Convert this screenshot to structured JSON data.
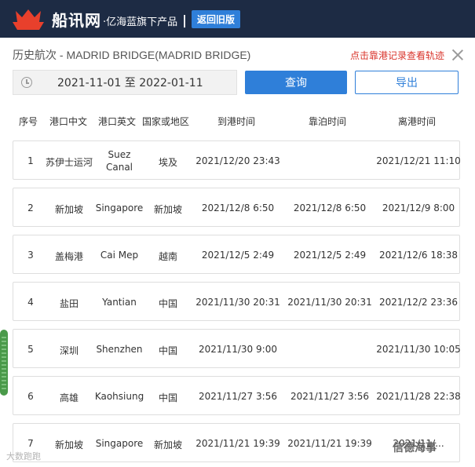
{
  "header": {
    "brand": "船讯网",
    "tagline": "·亿海蓝旗下产品",
    "separator": "|",
    "back_label": "返回旧版"
  },
  "page": {
    "title": "历史航次 - MADRID BRIDGE(MADRID BRIDGE)",
    "track_link": "点击靠港记录查看轨迹"
  },
  "filters": {
    "date_range": "2021-11-01 至 2022-01-11",
    "query_label": "查询",
    "export_label": "导出"
  },
  "table": {
    "columns": [
      "序号",
      "港口中文",
      "港口英文",
      "国家或地区",
      "到港时间",
      "靠泊时间",
      "离港时间"
    ],
    "rows": [
      {
        "no": "1",
        "port_cn": "苏伊士运河",
        "port_en_1": "Suez",
        "port_en_2": "Canal",
        "country": "埃及",
        "arrive": "2021/12/20 23:43",
        "berth": "",
        "depart": "2021/12/21 11:10"
      },
      {
        "no": "2",
        "port_cn": "新加坡",
        "port_en": "Singapore",
        "country": "新加坡",
        "arrive": "2021/12/8 6:50",
        "berth": "2021/12/8 6:50",
        "depart": "2021/12/9 8:00"
      },
      {
        "no": "3",
        "port_cn": "盖梅港",
        "port_en": "Cai Mep",
        "country": "越南",
        "arrive": "2021/12/5 2:49",
        "berth": "2021/12/5 2:49",
        "depart": "2021/12/6 18:38"
      },
      {
        "no": "4",
        "port_cn": "盐田",
        "port_en": "Yantian",
        "country": "中国",
        "arrive": "2021/11/30 20:31",
        "berth": "2021/11/30 20:31",
        "depart": "2021/12/2 23:36"
      },
      {
        "no": "5",
        "port_cn": "深圳",
        "port_en": "Shenzhen",
        "country": "中国",
        "arrive": "2021/11/30 9:00",
        "berth": "",
        "depart": "2021/11/30 10:05"
      },
      {
        "no": "6",
        "port_cn": "高雄",
        "port_en": "Kaohsiung",
        "country": "中国",
        "arrive": "2021/11/27 3:56",
        "berth": "2021/11/27 3:56",
        "depart": "2021/11/28 22:38"
      },
      {
        "no": "7",
        "port_cn": "新加坡",
        "port_en": "Singapore",
        "country": "新加坡",
        "arrive": "2021/11/21 19:39",
        "berth": "2021/11/21 19:39",
        "depart": "2021/11/..."
      }
    ]
  },
  "watermarks": {
    "left": "大数跑跑",
    "right": "信德海事"
  },
  "colors": {
    "topbar": "#1d2b44",
    "accent": "#2f7fd9",
    "link_red": "#d9342b"
  }
}
